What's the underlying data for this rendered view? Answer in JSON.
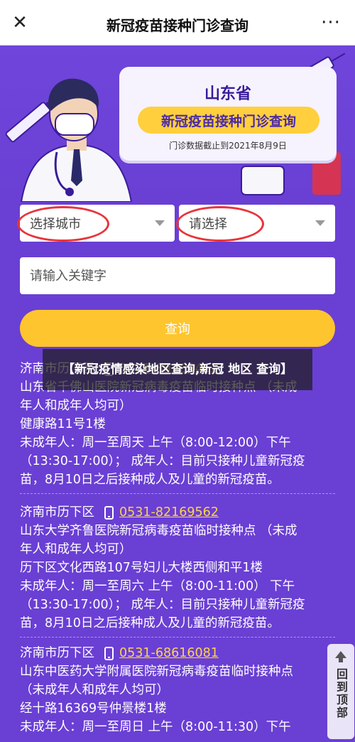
{
  "topbar": {
    "close_glyph": "✕",
    "title": "新冠疫苗接种门诊查询",
    "more_glyph": "···"
  },
  "banner": {
    "province": "山东省",
    "title": "新冠疫苗接种门诊查询",
    "date_note": "门诊数据截止到2021年8月9日"
  },
  "form": {
    "city_select": "选择城市",
    "district_select": "请选择",
    "keyword_placeholder": "请输入关键字",
    "query_label": "查询"
  },
  "overlay_caption": "【新冠疫情感染地区查询,新冠 地区 查询】",
  "results": [
    {
      "district": "济南市历下区",
      "phone": "0531-89269462",
      "name_lines": [
        "山东省千佛山医院新冠病毒疫苗临时接种点 （未成",
        "年人和成年人均可）"
      ],
      "address": "健康路11号1楼",
      "hours_lines": [
        "未成年人：周一至周天 上午（8:00-12:00）下午",
        "（13:30-17:00）； 成年人：目前只接种儿童新冠疫",
        "苗，8月10日之后接种成人及儿童的新冠疫苗。"
      ]
    },
    {
      "district": "济南市历下区",
      "phone": "0531-82169562",
      "name_lines": [
        "山东大学齐鲁医院新冠病毒疫苗临时接种点 （未成",
        "年人和成年人均可）"
      ],
      "address": "历下区文化西路107号妇儿大楼西侧和平1楼",
      "hours_lines": [
        "未成年人：周一至周六 上午（8:00-11:00） 下午",
        "（13:30-17:00）； 成年人：目前只接种儿童新冠疫",
        "苗，8月10日之后接种成人及儿童的新冠疫苗。"
      ]
    },
    {
      "district": "济南市历下区",
      "phone": "0531-68616081",
      "name_lines": [
        "山东中医药大学附属医院新冠病毒疫苗临时接种点",
        "（未成年人和成年人均可）"
      ],
      "address": "经十路16369号仲景楼1楼",
      "hours_lines": [
        "未成年人：周一至周日 上午（8:00-11:30）下午"
      ]
    }
  ],
  "back_to_top": "回到顶部",
  "colors": {
    "page_bg": "#6a3fd4",
    "accent_yellow": "#ffc52e",
    "phone_link": "#ffd34d",
    "annotation_red": "#e8343b"
  },
  "icons": {
    "close": "close-icon",
    "more": "more-icon",
    "phone": "phone-icon",
    "dropdown": "chevron-down-icon",
    "up": "arrow-up-icon"
  }
}
